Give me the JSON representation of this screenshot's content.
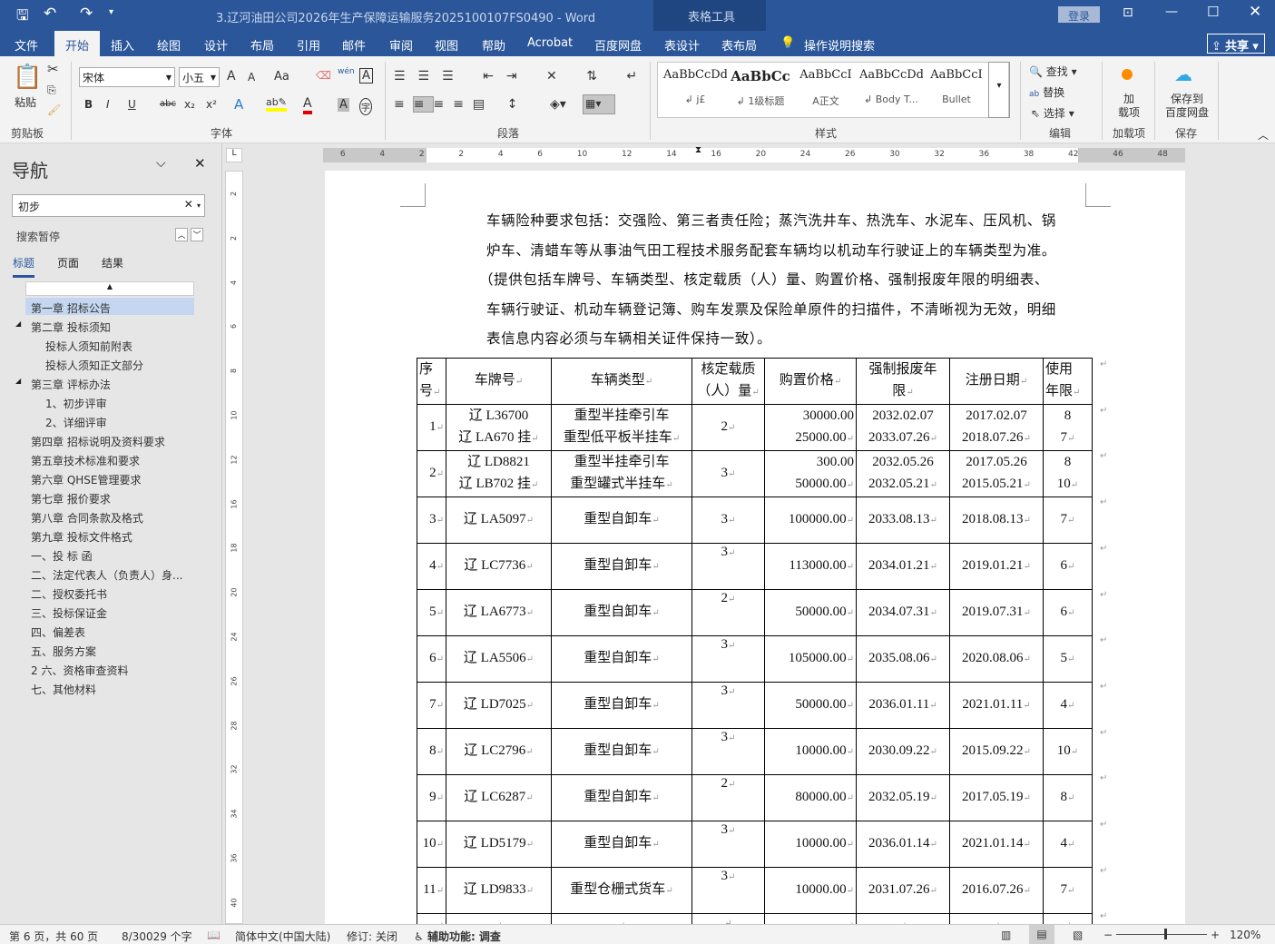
{
  "window": {
    "title": "3.辽河油田公司2026年生产保障运输服务2025100107FS0490  -  Word",
    "context_tab_group": "表格工具",
    "login": "登录",
    "share": "共享"
  },
  "tabs": [
    "文件",
    "开始",
    "插入",
    "绘图",
    "设计",
    "布局",
    "引用",
    "邮件",
    "审阅",
    "视图",
    "帮助",
    "Acrobat",
    "百度网盘",
    "表设计",
    "表布局"
  ],
  "tell_me": "操作说明搜索",
  "ribbon": {
    "clipboard": {
      "paste": "粘贴",
      "label": "剪贴板"
    },
    "font": {
      "name": "宋体",
      "size": "小五",
      "label": "字体",
      "bold": "B",
      "italic": "I",
      "underline": "U",
      "strike": "abc",
      "sub": "x₂",
      "sup": "x²",
      "aa": "Aa",
      "pinyin": "wén",
      "charborder": "A",
      "grow": "A",
      "shrink": "A",
      "colorA": "A",
      "phon": "字"
    },
    "paragraph": {
      "label": "段落"
    },
    "styles": {
      "label": "样式",
      "items": [
        {
          "preview": "AaBbCcDd",
          "name": "↲ j£"
        },
        {
          "preview": "AaBbCc",
          "name": "↲ 1级标题"
        },
        {
          "preview": "AaBbCcI",
          "name": "A正文"
        },
        {
          "preview": "AaBbCcDd",
          "name": "↲ Body T..."
        },
        {
          "preview": "AaBbCcI",
          "name": "Bullet"
        }
      ]
    },
    "editing": {
      "find": "查找",
      "replace": "替换",
      "select": "选择",
      "label": "编辑"
    },
    "addins": {
      "button": "加\n载项",
      "label": "加载项"
    },
    "save": {
      "button": "保存到\n百度网盘",
      "label": "保存"
    }
  },
  "colors": {
    "accent": "#2b579a",
    "highlight": "#ffff00",
    "font_color": "#e00000"
  },
  "nav": {
    "title": "导航",
    "search_value": "初步",
    "status": "搜索暂停",
    "tabs": [
      "标题",
      "页面",
      "结果"
    ],
    "items": [
      {
        "text": "第一章  招标公告",
        "level": 1,
        "selected": true
      },
      {
        "text": "第二章  投标须知",
        "level": 1,
        "expanded": true
      },
      {
        "text": "投标人须知前附表",
        "level": 2
      },
      {
        "text": "投标人须知正文部分",
        "level": 2
      },
      {
        "text": "第三章  评标办法",
        "level": 1,
        "expanded": true
      },
      {
        "text": "1、初步评审",
        "level": 2
      },
      {
        "text": "2、详细评审",
        "level": 2
      },
      {
        "text": "第四章  招标说明及资料要求",
        "level": 1
      },
      {
        "text": "第五章技术标准和要求",
        "level": 1
      },
      {
        "text": "第六章  QHSE管理要求",
        "level": 1
      },
      {
        "text": "第七章  报价要求",
        "level": 1
      },
      {
        "text": "第八章  合同条款及格式",
        "level": 1
      },
      {
        "text": "第九章  投标文件格式",
        "level": 1
      },
      {
        "text": "一、投 标 函",
        "level": 1
      },
      {
        "text": "二、法定代表人（负责人）身...",
        "level": 1
      },
      {
        "text": "二、授权委托书",
        "level": 1
      },
      {
        "text": "三、投标保证金",
        "level": 1
      },
      {
        "text": "四、偏差表",
        "level": 1
      },
      {
        "text": "五、服务方案",
        "level": 1
      },
      {
        "text": "2 六、资格审查资料",
        "level": 1
      },
      {
        "text": "七、其他材料",
        "level": 1
      }
    ]
  },
  "ruler": {
    "h_ticks": [
      "6",
      "4",
      "2",
      "2",
      "4",
      "6",
      "10",
      "12",
      "14",
      "16",
      "20",
      "24",
      "26",
      "30",
      "32",
      "36",
      "38",
      "42",
      "46",
      "48"
    ],
    "v_ticks": [
      "2",
      "2",
      "4",
      "6",
      "8",
      "10",
      "12",
      "16",
      "18",
      "20",
      "24",
      "26",
      "28",
      "32",
      "34",
      "36",
      "40"
    ]
  },
  "document": {
    "paragraph": [
      "车辆险种要求包括：交强险、第三者责任险；蒸汽洗井车、热洗车、水泥车、压风机、锅",
      "炉车、清蜡车等从事油气田工程技术服务配套车辆均以机动车行驶证上的车辆类型为准。",
      "（提供包括车牌号、车辆类型、核定载质（人）量、购置价格、强制报废年限的明细表、",
      "车辆行驶证、机动车辆登记簿、购车发票及保险单原件的扫描件，不清晰视为无效，明细",
      "表信息内容必须与车辆相关证件保持一致）。"
    ],
    "table": {
      "headers": [
        "序\n号",
        "车牌号",
        "车辆类型",
        "核定载质\n（人）量",
        "购置价格",
        "强制报废年\n限",
        "注册日期",
        "使用\n年限"
      ],
      "rows": [
        [
          "1",
          "辽 L36700\n辽 LA670 挂",
          "重型半挂牵引车\n重型低平板半挂车",
          "2",
          "30000.00\n25000.00",
          "2032.02.07\n2033.07.26",
          "2017.02.07\n2018.07.26",
          "8\n7"
        ],
        [
          "2",
          "辽 LD8821\n辽 LB702 挂",
          "重型半挂牵引车\n重型罐式半挂车",
          "3",
          "300.00\n50000.00",
          "2032.05.26\n2032.05.21",
          "2017.05.26\n2015.05.21",
          "8\n10"
        ],
        [
          "3",
          "辽 LA5097",
          "重型自卸车",
          "3",
          "100000.00",
          "2033.08.13",
          "2018.08.13",
          "7"
        ],
        [
          "4",
          "辽 LC7736",
          "重型自卸车",
          "3",
          "113000.00",
          "2034.01.21",
          "2019.01.21",
          "6"
        ],
        [
          "5",
          "辽 LA6773",
          "重型自卸车",
          "2",
          "50000.00",
          "2034.07.31",
          "2019.07.31",
          "6"
        ],
        [
          "6",
          "辽 LA5506",
          "重型自卸车",
          "3",
          "105000.00",
          "2035.08.06",
          "2020.08.06",
          "5"
        ],
        [
          "7",
          "辽 LD7025",
          "重型自卸车",
          "3",
          "50000.00",
          "2036.01.11",
          "2021.01.11",
          "4"
        ],
        [
          "8",
          "辽 LC2796",
          "重型自卸车",
          "3",
          "10000.00",
          "2030.09.22",
          "2015.09.22",
          "10"
        ],
        [
          "9",
          "辽 LC6287",
          "重型自卸车",
          "2",
          "80000.00",
          "2032.05.19",
          "2017.05.19",
          "8"
        ],
        [
          "10",
          "辽 LD5179",
          "重型自卸车",
          "3",
          "10000.00",
          "2036.01.14",
          "2021.01.14",
          "4"
        ],
        [
          "11",
          "辽 LD9833",
          "重型仓栅式货车",
          "3",
          "10000.00",
          "2031.07.26",
          "2016.07.26",
          "7"
        ]
      ]
    }
  },
  "status": {
    "page": "第 6 页，共 60 页",
    "words": "8/30029 个字",
    "language": "简体中文(中国大陆)",
    "track": "修订: 关闭",
    "accessibility": "辅助功能: 调查",
    "zoom": "120%",
    "zoom_level": 120
  }
}
